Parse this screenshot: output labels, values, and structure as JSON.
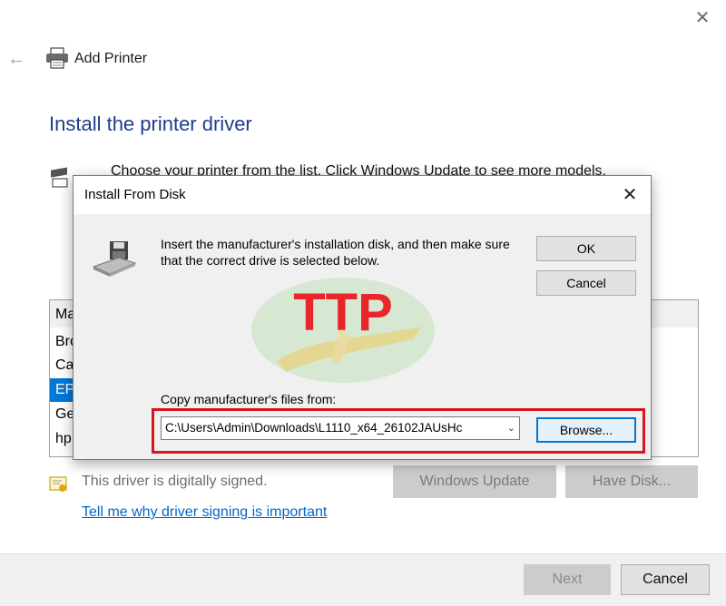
{
  "window": {
    "close_glyph": "✕"
  },
  "header": {
    "back_icon": "back-arrow-icon",
    "title": "Add Printer"
  },
  "main": {
    "heading": "Install the printer driver",
    "description": "Choose your printer from the list. Click Windows Update to see more models."
  },
  "list": {
    "rows": [
      {
        "label": "Ma",
        "selected": false
      },
      {
        "label": "Bro",
        "selected": false
      },
      {
        "label": "Ca",
        "selected": false
      },
      {
        "label": "EP",
        "selected": true
      },
      {
        "label": "Ge",
        "selected": false
      },
      {
        "label": "hp",
        "selected": false
      }
    ]
  },
  "signing": {
    "signed_text": "This driver is digitally signed.",
    "link_text": "Tell me why driver signing is important"
  },
  "buttons": {
    "windows_update": "Windows Update",
    "have_disk": "Have Disk...",
    "next": "Next",
    "cancel": "Cancel"
  },
  "dialog": {
    "title": "Install From Disk",
    "close_glyph": "✕",
    "message": "Insert the manufacturer's installation disk, and then make sure that the correct drive is selected below.",
    "ok": "OK",
    "cancel": "Cancel",
    "copy_label": "Copy manufacturer's files from:",
    "path_value": "C:\\Users\\Admin\\Downloads\\L1110_x64_26102JAUsHc",
    "browse": "Browse...",
    "watermark_text": "TTP"
  },
  "colors": {
    "accent": "#0078d7",
    "heading_blue": "#1e3c8c",
    "link": "#0066cc",
    "highlight_red": "#d8141c"
  }
}
